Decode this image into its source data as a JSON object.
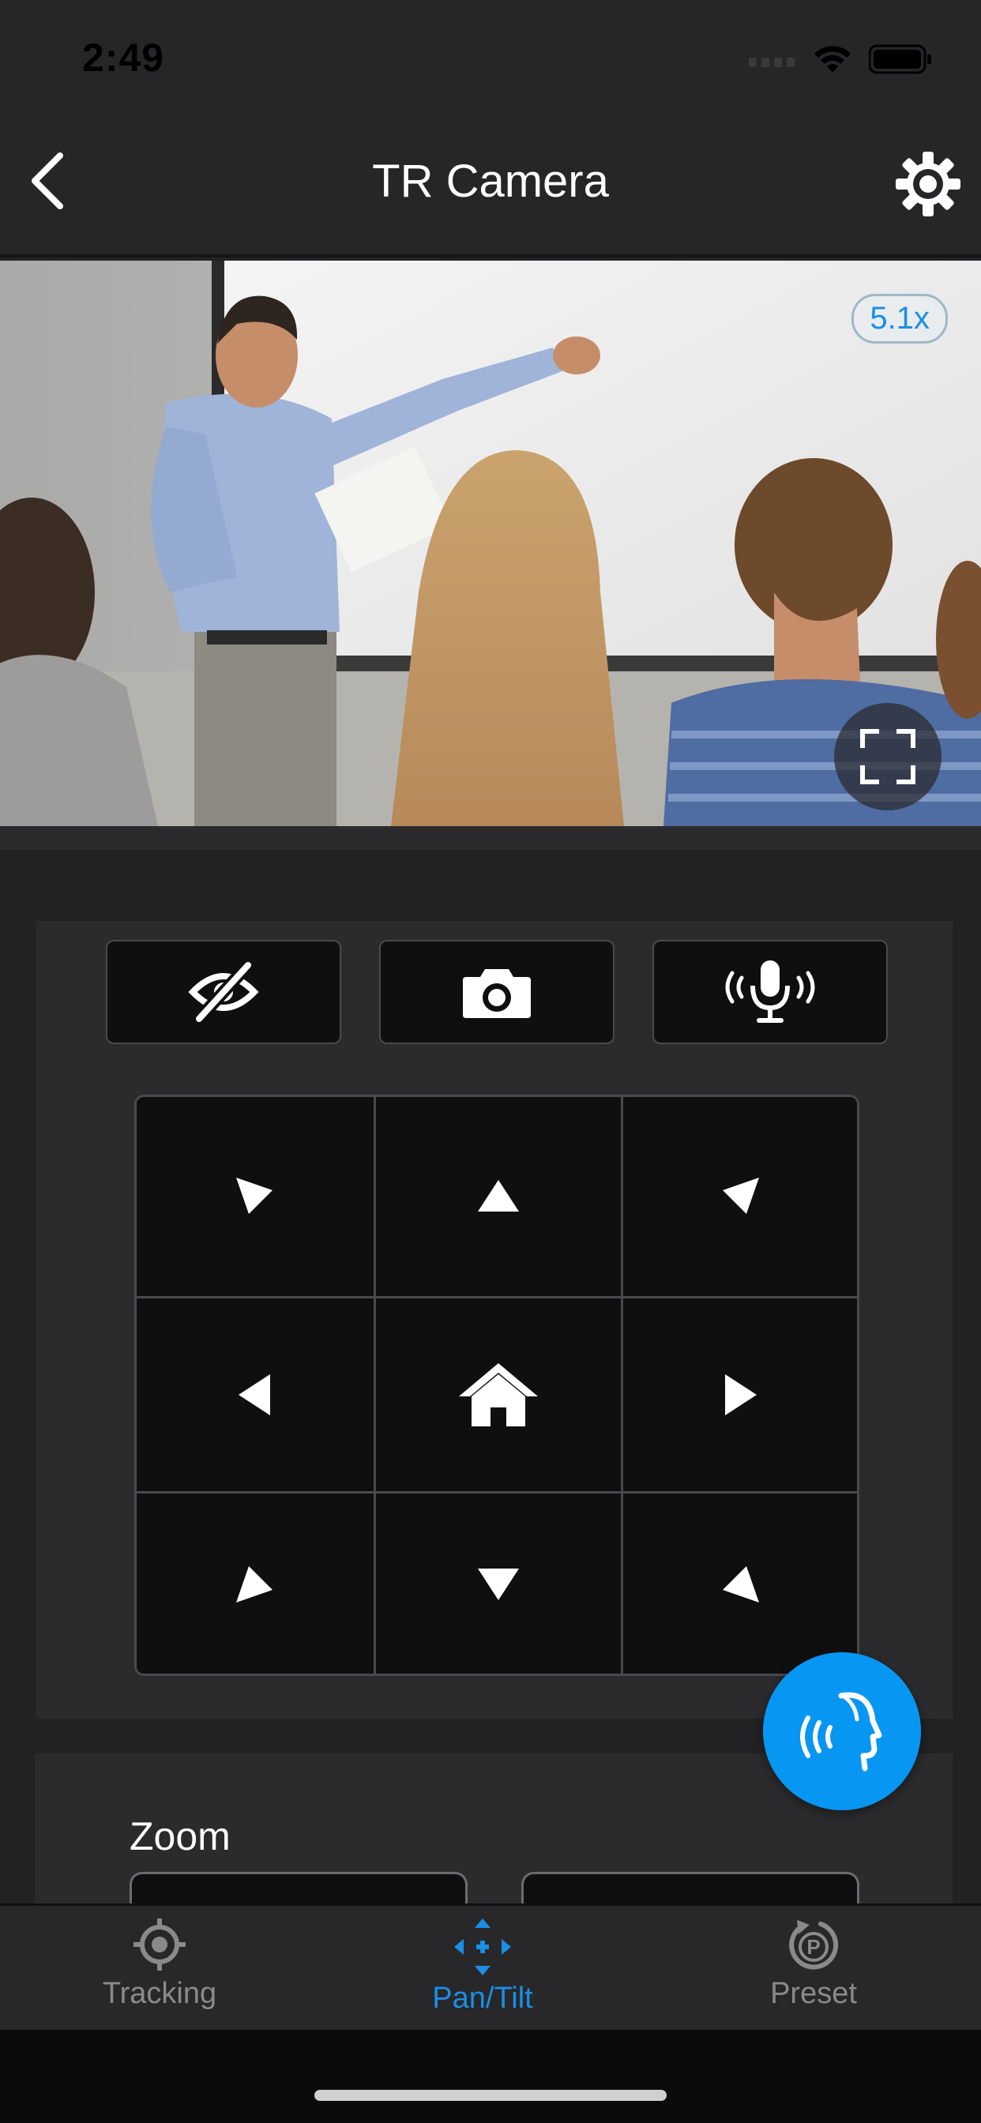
{
  "status_bar": {
    "time": "2:49"
  },
  "nav": {
    "title": "TR Camera",
    "back_icon": "chevron-left-icon",
    "settings_icon": "gear-icon"
  },
  "video": {
    "zoom_level": "5.1x",
    "fullscreen_icon": "fullscreen-icon"
  },
  "quick_actions": [
    {
      "name": "privacy-toggle",
      "icon": "eye-slash-icon"
    },
    {
      "name": "snapshot",
      "icon": "camera-icon"
    },
    {
      "name": "audio",
      "icon": "microphone-waves-icon"
    }
  ],
  "dpad": {
    "directions": [
      "up-left",
      "up",
      "up-right",
      "left",
      "home",
      "right",
      "down-left",
      "down",
      "down-right"
    ]
  },
  "voice_control": {
    "icon": "voice-command-icon",
    "color": "#0896f3"
  },
  "zoom": {
    "label": "Zoom"
  },
  "tabs": [
    {
      "label": "Tracking",
      "icon": "target-icon",
      "active": false
    },
    {
      "label": "Pan/Tilt",
      "icon": "move-arrows-icon",
      "active": true
    },
    {
      "label": "Preset",
      "icon": "preset-p-icon",
      "active": false
    }
  ],
  "colors": {
    "accent": "#1b8ee6",
    "background": "#222224",
    "panel": "#2b2b2d",
    "button": "#0f0f10"
  }
}
